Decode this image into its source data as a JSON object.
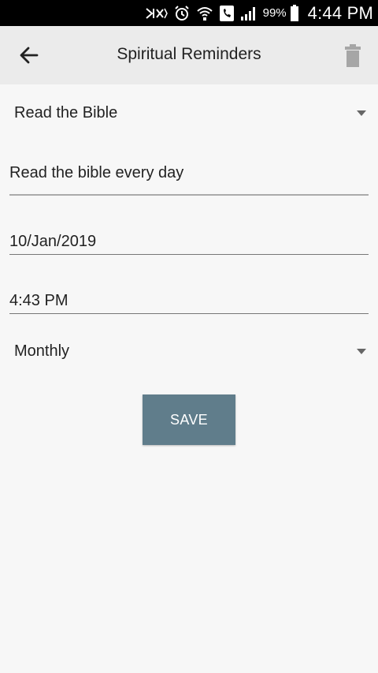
{
  "status_bar": {
    "battery_percent": "99%",
    "time": "4:44 PM"
  },
  "toolbar": {
    "title": "Spiritual Reminders",
    "back_icon": "arrow-left-icon",
    "delete_icon": "trash-icon"
  },
  "form": {
    "category": {
      "selected": "Read the Bible"
    },
    "description": {
      "value": "Read the bible every day"
    },
    "date": {
      "value": "10/Jan/2019"
    },
    "time": {
      "value": "4:43 PM"
    },
    "frequency": {
      "selected": "Monthly"
    },
    "save_label": "SAVE"
  },
  "colors": {
    "save_button": "#607d8b",
    "app_bar": "#ebebeb",
    "background": "#f7f7f7"
  }
}
